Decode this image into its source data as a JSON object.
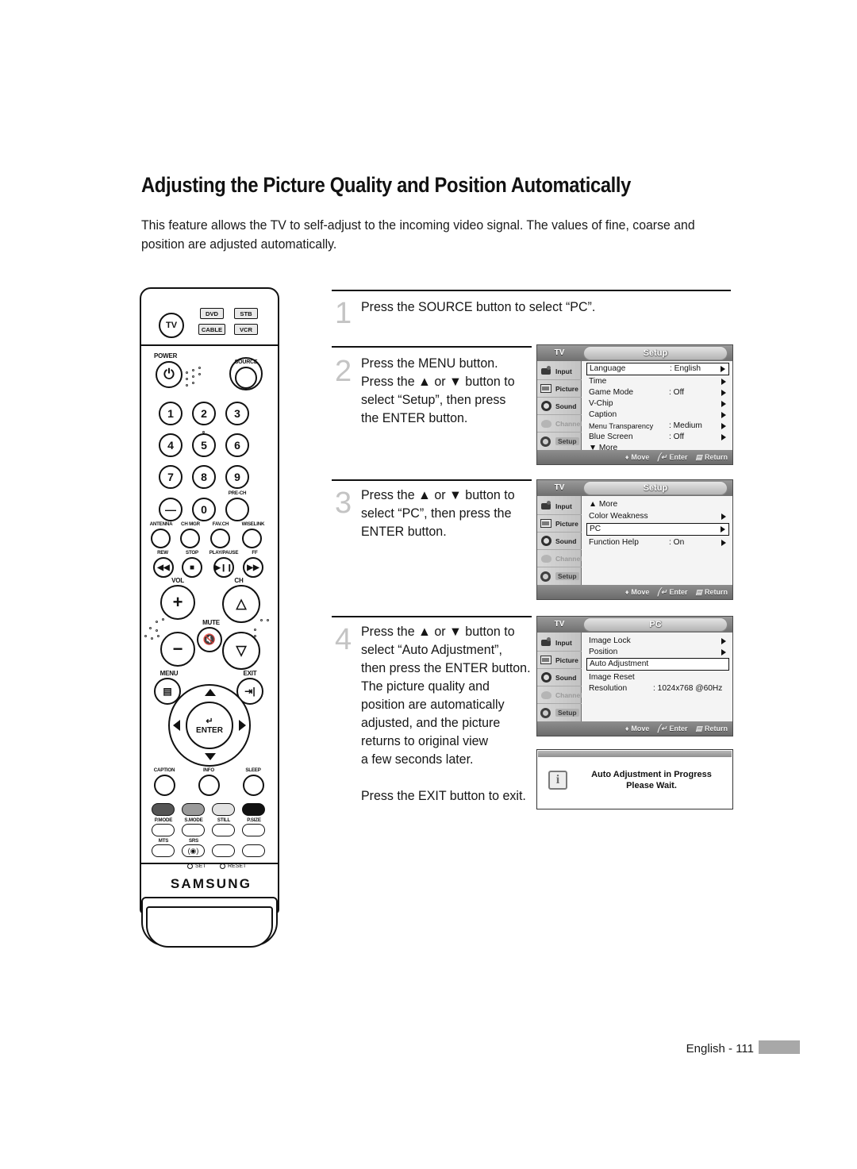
{
  "page": {
    "title": "Adjusting the Picture Quality and Position Automatically",
    "intro": "This feature allows the TV to self-adjust to the incoming video signal. The values of fine, coarse and position are adjusted automatically.",
    "footer_text": "English - 111"
  },
  "steps": [
    {
      "num": "1",
      "text": "Press the SOURCE button to select “PC”."
    },
    {
      "num": "2",
      "text": "Press the MENU button.\nPress the ▲ or ▼ button to\nselect “Setup”, then press\nthe ENTER button."
    },
    {
      "num": "3",
      "text": "Press the ▲ or ▼ button to\nselect “PC”, then press the\nENTER button."
    },
    {
      "num": "4",
      "text": "Press the ▲ or ▼ button to\nselect “Auto Adjustment”,\nthen press the ENTER button.\nThe picture quality and\nposition are automatically\nadjusted, and the picture\nreturns to original view\na few seconds later.\n\nPress the EXIT button to exit."
    }
  ],
  "osd": {
    "tv_label": "TV",
    "sidebar": [
      {
        "label": "Input",
        "icon": "input-icon",
        "state": "normal"
      },
      {
        "label": "Picture",
        "icon": "picture-icon",
        "state": "normal"
      },
      {
        "label": "Sound",
        "icon": "sound-icon",
        "state": "normal"
      },
      {
        "label": "Channel",
        "icon": "channel-icon",
        "state": "dim"
      },
      {
        "label": "Setup",
        "icon": "setup-icon",
        "state": "selected"
      }
    ],
    "footbar": {
      "move": "Move",
      "enter": "Enter",
      "return": "Return"
    },
    "screens": [
      {
        "title": "Setup",
        "sidebar_selected": "Setup",
        "rows": [
          {
            "label": "Language",
            "value": ": English",
            "arrow": true,
            "highlight": true
          },
          {
            "label": "Time",
            "value": "",
            "arrow": true,
            "highlight": false
          },
          {
            "label": "Game Mode",
            "value": ": Off",
            "arrow": true,
            "highlight": false
          },
          {
            "label": "V-Chip",
            "value": "",
            "arrow": true,
            "highlight": false
          },
          {
            "label": "Caption",
            "value": "",
            "arrow": true,
            "highlight": false
          },
          {
            "label": "Menu Transparency",
            "value": ": Medium",
            "arrow": true,
            "highlight": false
          },
          {
            "label": "Blue Screen",
            "value": ": Off",
            "arrow": true,
            "highlight": false
          },
          {
            "label": "▼ More",
            "value": "",
            "arrow": false,
            "highlight": false
          }
        ]
      },
      {
        "title": "Setup",
        "sidebar_selected": "Setup",
        "rows": [
          {
            "label": "▲ More",
            "value": "",
            "arrow": false,
            "highlight": false
          },
          {
            "label": "Color Weakness",
            "value": "",
            "arrow": true,
            "highlight": false
          },
          {
            "label": "PC",
            "value": "",
            "arrow": true,
            "highlight": true
          },
          {
            "label": "Function Help",
            "value": ": On",
            "arrow": true,
            "highlight": false
          }
        ]
      },
      {
        "title": "PC",
        "sidebar_selected": "Setup",
        "rows": [
          {
            "label": "Image Lock",
            "value": "",
            "arrow": true,
            "highlight": false
          },
          {
            "label": "Position",
            "value": "",
            "arrow": true,
            "highlight": false
          },
          {
            "label": "Auto Adjustment",
            "value": "",
            "arrow": false,
            "highlight": true
          },
          {
            "label": "Image Reset",
            "value": "",
            "arrow": false,
            "highlight": false
          },
          {
            "label": "Resolution",
            "value": ": 1024x768 @60Hz",
            "arrow": false,
            "highlight": false
          }
        ]
      }
    ]
  },
  "infobox": {
    "icon": "info-icon",
    "line1": "Auto Adjustment in Progress",
    "line2": "Please Wait."
  },
  "remote": {
    "brand": "SAMSUNG",
    "mode_buttons": [
      {
        "label": "TV",
        "shape": "round"
      },
      {
        "label": "DVD",
        "shape": "chip"
      },
      {
        "label": "STB",
        "shape": "chip"
      },
      {
        "label": "CABLE",
        "shape": "chip"
      },
      {
        "label": "VCR",
        "shape": "chip"
      }
    ],
    "power_label": "POWER",
    "source_label": "SOURCE",
    "numbers": [
      "1",
      "2",
      "3",
      "4",
      "5",
      "6",
      "7",
      "8",
      "9",
      "—",
      "0",
      ""
    ],
    "pre_ch_label": "PRE-CH",
    "function_row": [
      "ANTENNA",
      "CH MGR",
      "FAV.CH",
      "WISELINK"
    ],
    "transport": [
      "REW",
      "STOP",
      "PLAY/PAUSE",
      "FF"
    ],
    "vol_label": "VOL",
    "ch_label": "CH",
    "mute_label": "MUTE",
    "menu_label": "MENU",
    "exit_label": "EXIT",
    "enter_label": "ENTER",
    "bottom_row1": [
      "CAPTION",
      "INFO",
      "SLEEP"
    ],
    "color_row": [
      "P.MODE",
      "S.MODE",
      "STILL",
      "P.SIZE"
    ],
    "color_values": [
      "#555555",
      "#9a9a9a",
      "#e2e2e2",
      "#111111"
    ],
    "bottom_row2": [
      "MTS",
      "SRS",
      "",
      ""
    ],
    "set_label": "SET",
    "reset_label": "RESET"
  }
}
